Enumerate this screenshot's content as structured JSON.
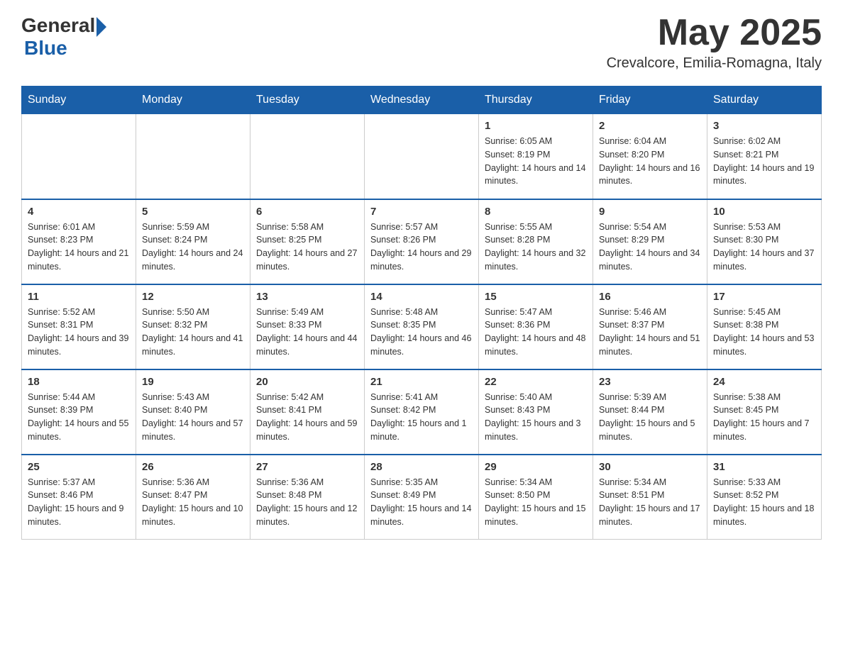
{
  "header": {
    "logo_general": "General",
    "logo_blue": "Blue",
    "month_title": "May 2025",
    "location": "Crevalcore, Emilia-Romagna, Italy"
  },
  "weekdays": [
    "Sunday",
    "Monday",
    "Tuesday",
    "Wednesday",
    "Thursday",
    "Friday",
    "Saturday"
  ],
  "weeks": [
    [
      {
        "day": "",
        "info": ""
      },
      {
        "day": "",
        "info": ""
      },
      {
        "day": "",
        "info": ""
      },
      {
        "day": "",
        "info": ""
      },
      {
        "day": "1",
        "info": "Sunrise: 6:05 AM\nSunset: 8:19 PM\nDaylight: 14 hours and 14 minutes."
      },
      {
        "day": "2",
        "info": "Sunrise: 6:04 AM\nSunset: 8:20 PM\nDaylight: 14 hours and 16 minutes."
      },
      {
        "day": "3",
        "info": "Sunrise: 6:02 AM\nSunset: 8:21 PM\nDaylight: 14 hours and 19 minutes."
      }
    ],
    [
      {
        "day": "4",
        "info": "Sunrise: 6:01 AM\nSunset: 8:23 PM\nDaylight: 14 hours and 21 minutes."
      },
      {
        "day": "5",
        "info": "Sunrise: 5:59 AM\nSunset: 8:24 PM\nDaylight: 14 hours and 24 minutes."
      },
      {
        "day": "6",
        "info": "Sunrise: 5:58 AM\nSunset: 8:25 PM\nDaylight: 14 hours and 27 minutes."
      },
      {
        "day": "7",
        "info": "Sunrise: 5:57 AM\nSunset: 8:26 PM\nDaylight: 14 hours and 29 minutes."
      },
      {
        "day": "8",
        "info": "Sunrise: 5:55 AM\nSunset: 8:28 PM\nDaylight: 14 hours and 32 minutes."
      },
      {
        "day": "9",
        "info": "Sunrise: 5:54 AM\nSunset: 8:29 PM\nDaylight: 14 hours and 34 minutes."
      },
      {
        "day": "10",
        "info": "Sunrise: 5:53 AM\nSunset: 8:30 PM\nDaylight: 14 hours and 37 minutes."
      }
    ],
    [
      {
        "day": "11",
        "info": "Sunrise: 5:52 AM\nSunset: 8:31 PM\nDaylight: 14 hours and 39 minutes."
      },
      {
        "day": "12",
        "info": "Sunrise: 5:50 AM\nSunset: 8:32 PM\nDaylight: 14 hours and 41 minutes."
      },
      {
        "day": "13",
        "info": "Sunrise: 5:49 AM\nSunset: 8:33 PM\nDaylight: 14 hours and 44 minutes."
      },
      {
        "day": "14",
        "info": "Sunrise: 5:48 AM\nSunset: 8:35 PM\nDaylight: 14 hours and 46 minutes."
      },
      {
        "day": "15",
        "info": "Sunrise: 5:47 AM\nSunset: 8:36 PM\nDaylight: 14 hours and 48 minutes."
      },
      {
        "day": "16",
        "info": "Sunrise: 5:46 AM\nSunset: 8:37 PM\nDaylight: 14 hours and 51 minutes."
      },
      {
        "day": "17",
        "info": "Sunrise: 5:45 AM\nSunset: 8:38 PM\nDaylight: 14 hours and 53 minutes."
      }
    ],
    [
      {
        "day": "18",
        "info": "Sunrise: 5:44 AM\nSunset: 8:39 PM\nDaylight: 14 hours and 55 minutes."
      },
      {
        "day": "19",
        "info": "Sunrise: 5:43 AM\nSunset: 8:40 PM\nDaylight: 14 hours and 57 minutes."
      },
      {
        "day": "20",
        "info": "Sunrise: 5:42 AM\nSunset: 8:41 PM\nDaylight: 14 hours and 59 minutes."
      },
      {
        "day": "21",
        "info": "Sunrise: 5:41 AM\nSunset: 8:42 PM\nDaylight: 15 hours and 1 minute."
      },
      {
        "day": "22",
        "info": "Sunrise: 5:40 AM\nSunset: 8:43 PM\nDaylight: 15 hours and 3 minutes."
      },
      {
        "day": "23",
        "info": "Sunrise: 5:39 AM\nSunset: 8:44 PM\nDaylight: 15 hours and 5 minutes."
      },
      {
        "day": "24",
        "info": "Sunrise: 5:38 AM\nSunset: 8:45 PM\nDaylight: 15 hours and 7 minutes."
      }
    ],
    [
      {
        "day": "25",
        "info": "Sunrise: 5:37 AM\nSunset: 8:46 PM\nDaylight: 15 hours and 9 minutes."
      },
      {
        "day": "26",
        "info": "Sunrise: 5:36 AM\nSunset: 8:47 PM\nDaylight: 15 hours and 10 minutes."
      },
      {
        "day": "27",
        "info": "Sunrise: 5:36 AM\nSunset: 8:48 PM\nDaylight: 15 hours and 12 minutes."
      },
      {
        "day": "28",
        "info": "Sunrise: 5:35 AM\nSunset: 8:49 PM\nDaylight: 15 hours and 14 minutes."
      },
      {
        "day": "29",
        "info": "Sunrise: 5:34 AM\nSunset: 8:50 PM\nDaylight: 15 hours and 15 minutes."
      },
      {
        "day": "30",
        "info": "Sunrise: 5:34 AM\nSunset: 8:51 PM\nDaylight: 15 hours and 17 minutes."
      },
      {
        "day": "31",
        "info": "Sunrise: 5:33 AM\nSunset: 8:52 PM\nDaylight: 15 hours and 18 minutes."
      }
    ]
  ]
}
